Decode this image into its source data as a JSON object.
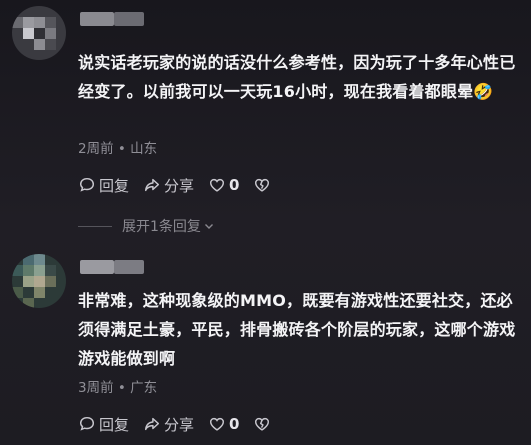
{
  "comments": [
    {
      "text": "说实话老玩家的说的话没什么参考性，因为玩了十多年心性已经变了。以前我可以一天玩16小时，现在我看着都眼晕🤣",
      "meta": "2周前 • 山东",
      "reply_label": "回复",
      "share_label": "分享",
      "like_count": "0",
      "expand_label": "展开1条回复"
    },
    {
      "text": "非常难，这种现象级的MMO，既要有游戏性还要社交，还必须得满足土豪，平民，排骨搬砖各个阶层的玩家，这哪个游戏游戏能做到啊",
      "meta": "3周前 • 广东",
      "reply_label": "回复",
      "share_label": "分享",
      "like_count": "0"
    }
  ],
  "icons": {
    "reply": "comment-bubble-icon",
    "share": "share-arrow-icon",
    "like": "heart-icon",
    "dislike": "broken-heart-icon",
    "expand": "chevron-down-icon"
  }
}
